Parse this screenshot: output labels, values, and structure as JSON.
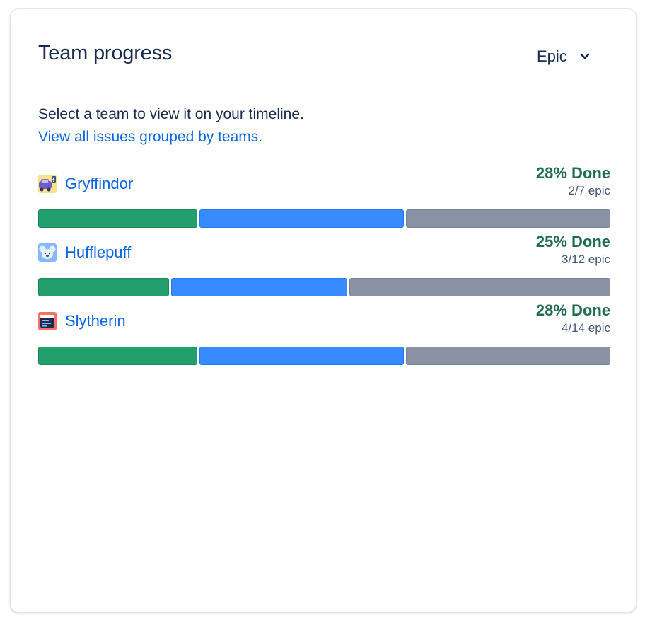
{
  "panel": {
    "title": "Team progress",
    "grouping": {
      "selected": "Epic"
    },
    "description": "Select a team to view it on your timeline.",
    "view_all_link": "View all issues grouped by teams."
  },
  "teams": [
    {
      "name": "Gryffindor",
      "avatar_icon": "purple-car-avatar-icon",
      "done_label": "28% Done",
      "count_label": "2/7 epic",
      "progress": {
        "done": 0.28,
        "in_progress": 0.36,
        "todo": 0.36
      }
    },
    {
      "name": "Hufflepuff",
      "avatar_icon": "blue-koala-avatar-icon",
      "done_label": "25% Done",
      "count_label": "3/12 epic",
      "progress": {
        "done": 0.23,
        "in_progress": 0.31,
        "todo": 0.46
      }
    },
    {
      "name": "Slytherin",
      "avatar_icon": "red-browser-avatar-icon",
      "done_label": "28% Done",
      "count_label": "4/14 epic",
      "progress": {
        "done": 0.28,
        "in_progress": 0.36,
        "todo": 0.36
      }
    }
  ],
  "colors": {
    "done": "#22a06b",
    "in_progress": "#388bff",
    "todo": "#8993a5",
    "link": "#0c66e4",
    "done_text": "#216e4e"
  }
}
